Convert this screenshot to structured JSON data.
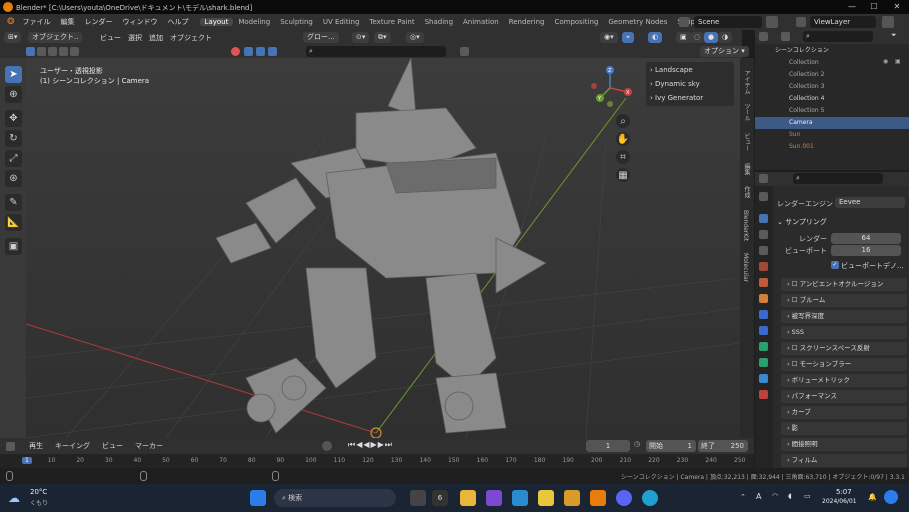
{
  "titlebar": {
    "title": "Blender* [C:\\Users\\youta\\OneDrive\\ドキュメント\\モデル\\shark.blend]",
    "minimize": "—",
    "maximize": "☐",
    "close": "✕"
  },
  "menubar": {
    "items": [
      "ファイル",
      "編集",
      "レンダー",
      "ウィンドウ",
      "ヘルプ"
    ],
    "workspaces": [
      "Layout",
      "Modeling",
      "Sculpting",
      "UV Editing",
      "Texture Paint",
      "Shading",
      "Animation",
      "Rendering",
      "Compositing",
      "Geometry Nodes",
      "Scripting"
    ],
    "active_workspace": "Layout",
    "add_tab": "+",
    "scene": "Scene",
    "view_layer": "ViewLayer"
  },
  "viewport_header": {
    "mode": "オブジェクト..",
    "menus": [
      "ビュー",
      "選択",
      "追加",
      "オブジェクト"
    ],
    "transform": "グロー...",
    "options": "オプション ▾"
  },
  "viewport": {
    "view_label": "ユーザー・透視投影",
    "collection_label": "(1) シーンコレクション | Camera",
    "npanel": [
      "Landscape",
      "Dynamic sky",
      "Ivy Generator"
    ],
    "gizmo": {
      "x": "X",
      "y": "Y",
      "z": "Z"
    }
  },
  "side_tabs": [
    "アイテム",
    "ツール",
    "ビュー",
    "編集",
    "作成",
    "BlenderKit",
    "Molecular"
  ],
  "outliner": {
    "root": "シーンコレクション",
    "items": [
      {
        "label": "Collection"
      },
      {
        "label": "Collection 2"
      },
      {
        "label": "Collection 3"
      },
      {
        "label": "Collection 4"
      },
      {
        "label": "Collection 5"
      },
      {
        "label": "Camera"
      },
      {
        "label": "Sun"
      },
      {
        "label": "Sun.001"
      }
    ],
    "selected": "Camera"
  },
  "properties": {
    "engine_label": "レンダーエンジン",
    "engine": "Eevee",
    "section": "サンプリング",
    "render_label": "レンダー",
    "render_value": "64",
    "viewport_label": "ビューポート",
    "viewport_value": "16",
    "denoise_label": "ビューポートデノ...",
    "panels": [
      "アンビエントオクルージョン",
      "ブルーム",
      "被写界深度",
      "SSS",
      "スクリーンスペース反射",
      "モーションブラー",
      "ボリューメトリック",
      "パフォーマンス",
      "カーブ",
      "影",
      "間接照明",
      "フィルム"
    ]
  },
  "timeline": {
    "menus": [
      "再生",
      "キーイング",
      "ビュー",
      "マーカー"
    ],
    "current_frame": "1",
    "start_label": "開始",
    "start": "1",
    "end_label": "終了",
    "end": "250"
  },
  "ruler": {
    "ticks": [
      "1",
      "10",
      "20",
      "30",
      "40",
      "50",
      "60",
      "70",
      "80",
      "90",
      "100",
      "110",
      "120",
      "130",
      "140",
      "150",
      "160",
      "170",
      "180",
      "190",
      "200",
      "210",
      "220",
      "230",
      "240",
      "250"
    ]
  },
  "statusbar": {
    "text": "シーンコレクション | Camera | 頂点:32,213 | 面:32,944 | 三角面:63,710 | オブジェクト:0/97 | 3.3.1"
  },
  "taskbar": {
    "weather_temp": "20°C",
    "weather_desc": "くもり",
    "search": "検索",
    "time": "5:07",
    "date": "2024/06/01",
    "lang": "A",
    "badge": "6"
  }
}
